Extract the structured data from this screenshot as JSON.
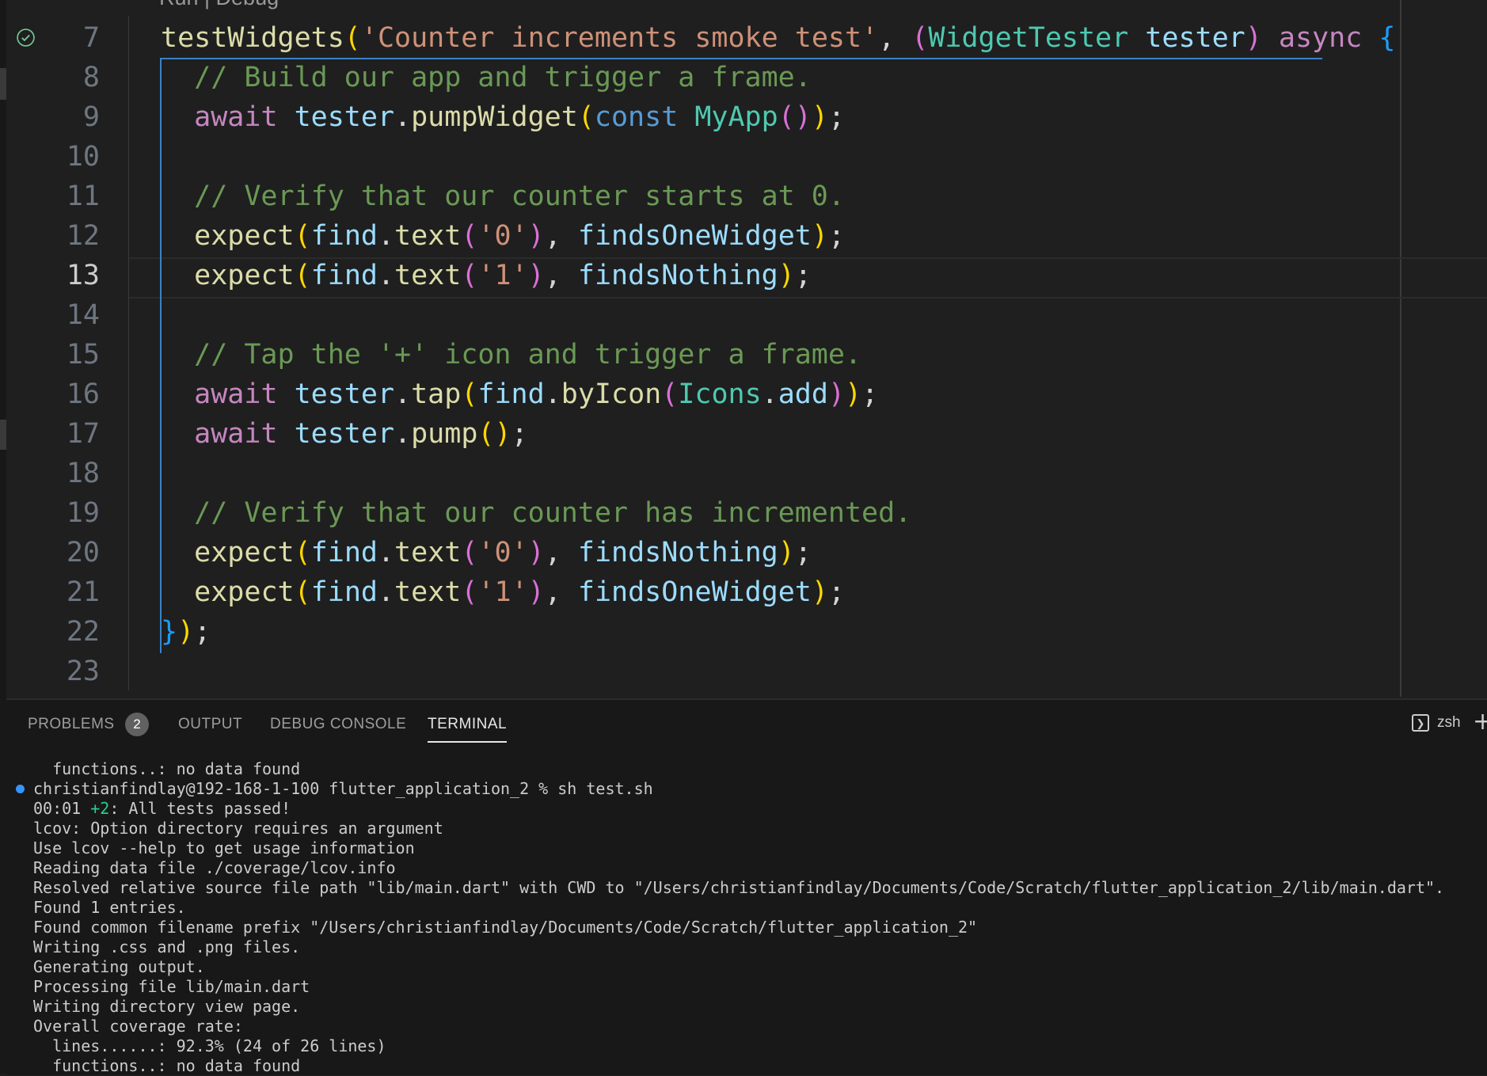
{
  "editor": {
    "codelens": "Run | Debug",
    "active_line": "13",
    "lines": [
      {
        "num": "7",
        "tokens": [
          {
            "t": "testWidgets",
            "c": "fn"
          },
          {
            "t": "(",
            "c": "p1"
          },
          {
            "t": "'Counter increments smoke test'",
            "c": "str"
          },
          {
            "t": ", ",
            "c": "plain"
          },
          {
            "t": "(",
            "c": "p2"
          },
          {
            "t": "WidgetTester",
            "c": "type"
          },
          {
            "t": " ",
            "c": "plain"
          },
          {
            "t": "tester",
            "c": "var"
          },
          {
            "t": ")",
            "c": "p2"
          },
          {
            "t": " ",
            "c": "plain"
          },
          {
            "t": "async",
            "c": "kw"
          },
          {
            "t": " ",
            "c": "plain"
          },
          {
            "t": "{",
            "c": "p3"
          }
        ]
      },
      {
        "num": "8",
        "tokens": [
          {
            "t": "  // Build our app and trigger a frame.",
            "c": "com"
          }
        ]
      },
      {
        "num": "9",
        "tokens": [
          {
            "t": "  ",
            "c": "plain"
          },
          {
            "t": "await",
            "c": "kw"
          },
          {
            "t": " ",
            "c": "plain"
          },
          {
            "t": "tester",
            "c": "var"
          },
          {
            "t": ".",
            "c": "plain"
          },
          {
            "t": "pumpWidget",
            "c": "fn"
          },
          {
            "t": "(",
            "c": "p1"
          },
          {
            "t": "const",
            "c": "kw2"
          },
          {
            "t": " ",
            "c": "plain"
          },
          {
            "t": "MyApp",
            "c": "type"
          },
          {
            "t": "()",
            "c": "p2"
          },
          {
            "t": ")",
            "c": "p1"
          },
          {
            "t": ";",
            "c": "plain"
          }
        ]
      },
      {
        "num": "10",
        "tokens": []
      },
      {
        "num": "11",
        "tokens": [
          {
            "t": "  // Verify that our counter starts at 0.",
            "c": "com"
          }
        ]
      },
      {
        "num": "12",
        "tokens": [
          {
            "t": "  ",
            "c": "plain"
          },
          {
            "t": "expect",
            "c": "fn"
          },
          {
            "t": "(",
            "c": "p1"
          },
          {
            "t": "find",
            "c": "var"
          },
          {
            "t": ".",
            "c": "plain"
          },
          {
            "t": "text",
            "c": "fn"
          },
          {
            "t": "(",
            "c": "p2"
          },
          {
            "t": "'0'",
            "c": "str"
          },
          {
            "t": ")",
            "c": "p2"
          },
          {
            "t": ", ",
            "c": "plain"
          },
          {
            "t": "findsOneWidget",
            "c": "var"
          },
          {
            "t": ")",
            "c": "p1"
          },
          {
            "t": ";",
            "c": "plain"
          }
        ]
      },
      {
        "num": "13",
        "tokens": [
          {
            "t": "  ",
            "c": "plain"
          },
          {
            "t": "expect",
            "c": "fn"
          },
          {
            "t": "(",
            "c": "p1"
          },
          {
            "t": "find",
            "c": "var"
          },
          {
            "t": ".",
            "c": "plain"
          },
          {
            "t": "text",
            "c": "fn"
          },
          {
            "t": "(",
            "c": "p2"
          },
          {
            "t": "'1'",
            "c": "str"
          },
          {
            "t": ")",
            "c": "p2"
          },
          {
            "t": ", ",
            "c": "plain"
          },
          {
            "t": "findsNothing",
            "c": "var"
          },
          {
            "t": ")",
            "c": "p1"
          },
          {
            "t": ";",
            "c": "plain"
          }
        ]
      },
      {
        "num": "14",
        "tokens": []
      },
      {
        "num": "15",
        "tokens": [
          {
            "t": "  // Tap the '+' icon and trigger a frame.",
            "c": "com"
          }
        ]
      },
      {
        "num": "16",
        "tokens": [
          {
            "t": "  ",
            "c": "plain"
          },
          {
            "t": "await",
            "c": "kw"
          },
          {
            "t": " ",
            "c": "plain"
          },
          {
            "t": "tester",
            "c": "var"
          },
          {
            "t": ".",
            "c": "plain"
          },
          {
            "t": "tap",
            "c": "fn"
          },
          {
            "t": "(",
            "c": "p1"
          },
          {
            "t": "find",
            "c": "var"
          },
          {
            "t": ".",
            "c": "plain"
          },
          {
            "t": "byIcon",
            "c": "fn"
          },
          {
            "t": "(",
            "c": "p2"
          },
          {
            "t": "Icons",
            "c": "type"
          },
          {
            "t": ".",
            "c": "plain"
          },
          {
            "t": "add",
            "c": "var"
          },
          {
            "t": ")",
            "c": "p2"
          },
          {
            "t": ")",
            "c": "p1"
          },
          {
            "t": ";",
            "c": "plain"
          }
        ]
      },
      {
        "num": "17",
        "tokens": [
          {
            "t": "  ",
            "c": "plain"
          },
          {
            "t": "await",
            "c": "kw"
          },
          {
            "t": " ",
            "c": "plain"
          },
          {
            "t": "tester",
            "c": "var"
          },
          {
            "t": ".",
            "c": "plain"
          },
          {
            "t": "pump",
            "c": "fn"
          },
          {
            "t": "()",
            "c": "p1"
          },
          {
            "t": ";",
            "c": "plain"
          }
        ]
      },
      {
        "num": "18",
        "tokens": []
      },
      {
        "num": "19",
        "tokens": [
          {
            "t": "  // Verify that our counter has incremented.",
            "c": "com"
          }
        ]
      },
      {
        "num": "20",
        "tokens": [
          {
            "t": "  ",
            "c": "plain"
          },
          {
            "t": "expect",
            "c": "fn"
          },
          {
            "t": "(",
            "c": "p1"
          },
          {
            "t": "find",
            "c": "var"
          },
          {
            "t": ".",
            "c": "plain"
          },
          {
            "t": "text",
            "c": "fn"
          },
          {
            "t": "(",
            "c": "p2"
          },
          {
            "t": "'0'",
            "c": "str"
          },
          {
            "t": ")",
            "c": "p2"
          },
          {
            "t": ", ",
            "c": "plain"
          },
          {
            "t": "findsNothing",
            "c": "var"
          },
          {
            "t": ")",
            "c": "p1"
          },
          {
            "t": ";",
            "c": "plain"
          }
        ]
      },
      {
        "num": "21",
        "tokens": [
          {
            "t": "  ",
            "c": "plain"
          },
          {
            "t": "expect",
            "c": "fn"
          },
          {
            "t": "(",
            "c": "p1"
          },
          {
            "t": "find",
            "c": "var"
          },
          {
            "t": ".",
            "c": "plain"
          },
          {
            "t": "text",
            "c": "fn"
          },
          {
            "t": "(",
            "c": "p2"
          },
          {
            "t": "'1'",
            "c": "str"
          },
          {
            "t": ")",
            "c": "p2"
          },
          {
            "t": ", ",
            "c": "plain"
          },
          {
            "t": "findsOneWidget",
            "c": "var"
          },
          {
            "t": ")",
            "c": "p1"
          },
          {
            "t": ";",
            "c": "plain"
          }
        ]
      },
      {
        "num": "22",
        "tokens": [
          {
            "t": "}",
            "c": "p3"
          },
          {
            "t": ")",
            "c": "p1"
          },
          {
            "t": ";",
            "c": "plain"
          }
        ]
      },
      {
        "num": "23",
        "tokens": []
      }
    ]
  },
  "panel": {
    "tabs": [
      {
        "label": "PROBLEMS",
        "badge": "2"
      },
      {
        "label": "OUTPUT"
      },
      {
        "label": "DEBUG CONSOLE"
      },
      {
        "label": "TERMINAL",
        "active": true
      }
    ],
    "terminal_name": "zsh",
    "terminal_lines": [
      {
        "text": "  functions..: no data found"
      },
      {
        "text": "christianfindlay@192-168-1-100 flutter_application_2 % sh test.sh",
        "prompt": true
      },
      {
        "segments": [
          {
            "t": "00:01 ",
            "c": ""
          },
          {
            "t": "+2",
            "c": "green"
          },
          {
            "t": ": All tests passed!",
            "c": ""
          }
        ]
      },
      {
        "text": "lcov: Option directory requires an argument"
      },
      {
        "text": "Use lcov --help to get usage information"
      },
      {
        "text": "Reading data file ./coverage/lcov.info"
      },
      {
        "text": "Resolved relative source file path \"lib/main.dart\" with CWD to \"/Users/christianfindlay/Documents/Code/Scratch/flutter_application_2/lib/main.dart\"."
      },
      {
        "text": "Found 1 entries."
      },
      {
        "text": "Found common filename prefix \"/Users/christianfindlay/Documents/Code/Scratch/flutter_application_2\""
      },
      {
        "text": "Writing .css and .png files."
      },
      {
        "text": "Generating output."
      },
      {
        "text": "Processing file lib/main.dart"
      },
      {
        "text": "Writing directory view page."
      },
      {
        "text": "Overall coverage rate:"
      },
      {
        "text": "  lines......: 92.3% (24 of 26 lines)"
      },
      {
        "text": "  functions..: no data found"
      }
    ]
  }
}
